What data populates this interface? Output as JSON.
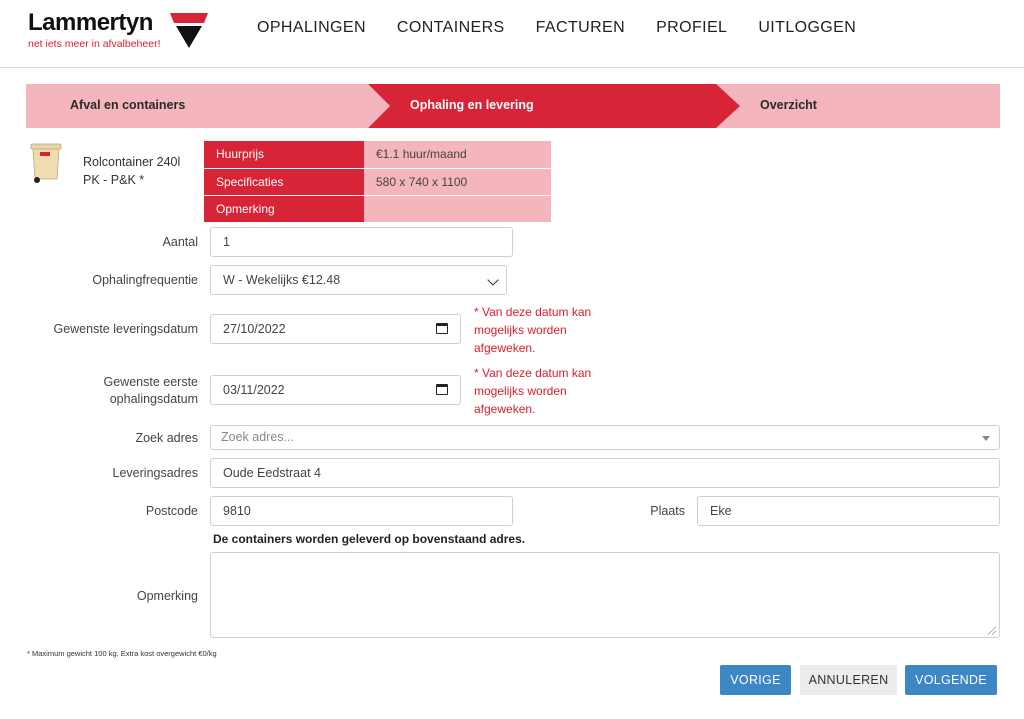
{
  "brand": {
    "name": "Lammertyn",
    "tagline": "net iets meer in afvalbeheer!",
    "accent": "#d72436"
  },
  "nav": [
    "OPHALINGEN",
    "CONTAINERS",
    "FACTUREN",
    "PROFIEL",
    "UITLOGGEN"
  ],
  "steps": [
    {
      "label": "Afval en containers",
      "active": false
    },
    {
      "label": "Ophaling en levering",
      "active": true
    },
    {
      "label": "Overzicht",
      "active": false
    }
  ],
  "product": {
    "name": "Rolcontainer 240l PK - P&K *",
    "specs": [
      {
        "key": "Huurprijs",
        "value": "€1.1 huur/maand"
      },
      {
        "key": "Specificaties",
        "value": "580 x 740 x 1100"
      },
      {
        "key": "Opmerking",
        "value": ""
      }
    ]
  },
  "form": {
    "aantal_label": "Aantal",
    "aantal_value": "1",
    "frequentie_label": "Ophalingfrequentie",
    "frequentie_value": "W - Wekelijks €12.48",
    "levering_label": "Gewenste leveringsdatum",
    "levering_value": "27/10/2022",
    "ophaling_label_1": "Gewenste eerste",
    "ophaling_label_2": "ophalingsdatum",
    "ophaling_value": "03/11/2022",
    "date_note": "* Van deze datum kan mogelijks worden afgeweken.",
    "zoek_label": "Zoek adres",
    "zoek_placeholder": "Zoek adres...",
    "adres_label": "Leveringsadres",
    "adres_value": "Oude Eedstraat 4",
    "postcode_label": "Postcode",
    "postcode_value": "9810",
    "plaats_label": "Plaats",
    "plaats_value": "Eke",
    "delivery_info": "De containers worden geleverd op bovenstaand adres.",
    "opmerking_label": "Opmerking",
    "opmerking_value": ""
  },
  "footnote": "* Maximum gewicht 100 kg. Extra kost overgewicht €0/kg",
  "buttons": {
    "prev": "VORIGE",
    "cancel": "ANNULEREN",
    "next": "VOLGENDE"
  }
}
